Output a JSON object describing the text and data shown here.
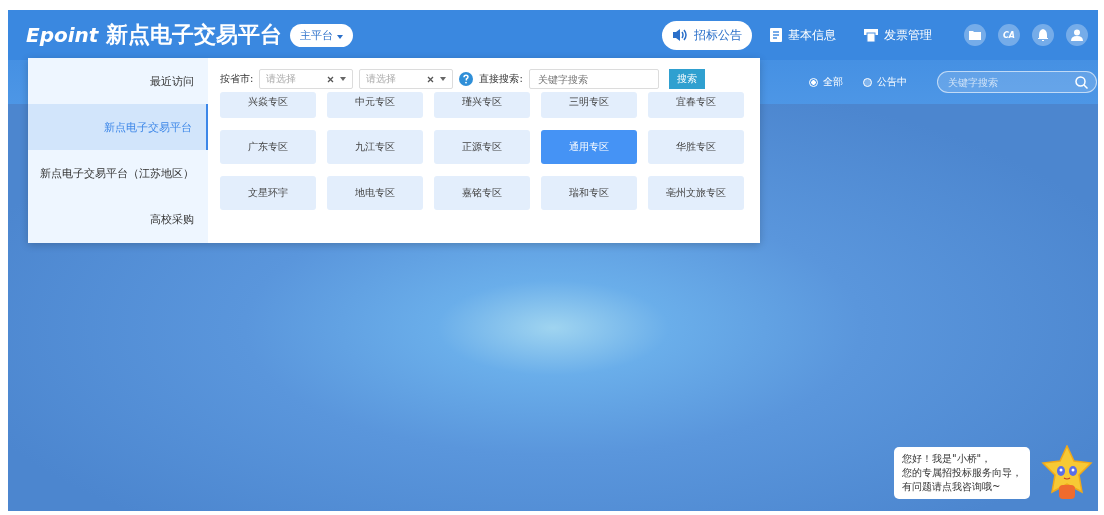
{
  "header": {
    "logo_text": "Epoint",
    "title": "新点电子交易平台",
    "platform_button": "主平台",
    "nav": [
      {
        "label": "招标公告",
        "kind": "speaker",
        "selected": true
      },
      {
        "label": "基本信息",
        "kind": "document",
        "selected": false
      },
      {
        "label": "发票管理",
        "kind": "printer",
        "selected": false
      }
    ],
    "ca_label": "CA"
  },
  "filter_bar": {
    "radios": [
      {
        "label": "全部",
        "selected": true
      },
      {
        "label": "公告中",
        "selected": false
      }
    ],
    "search": {
      "placeholder": "关键字搜索"
    }
  },
  "platform_menu": {
    "sidebar": [
      {
        "label": "最近访问",
        "selected": false
      },
      {
        "label": "新点电子交易平台",
        "selected": true
      },
      {
        "label": "新点电子交易平台（江苏地区）",
        "selected": false
      },
      {
        "label": "高校采购",
        "selected": false
      }
    ],
    "province_label": "按省市:",
    "selects": [
      {
        "placeholder": "请选择"
      },
      {
        "placeholder": "请选择"
      }
    ],
    "search_label": "直接搜索:",
    "search_placeholder": "关键字搜索",
    "search_button": "搜索",
    "zones": [
      {
        "label": "兴焱专区",
        "selected": false
      },
      {
        "label": "中元专区",
        "selected": false
      },
      {
        "label": "瑾兴专区",
        "selected": false
      },
      {
        "label": "三明专区",
        "selected": false
      },
      {
        "label": "宜春专区",
        "selected": false
      },
      {
        "label": "广东专区",
        "selected": false
      },
      {
        "label": "九江专区",
        "selected": false
      },
      {
        "label": "正源专区",
        "selected": false
      },
      {
        "label": "通用专区",
        "selected": true
      },
      {
        "label": "华胜专区",
        "selected": false
      },
      {
        "label": "文星环宇",
        "selected": false
      },
      {
        "label": "地电专区",
        "selected": false
      },
      {
        "label": "嘉铭专区",
        "selected": false
      },
      {
        "label": "瑞和专区",
        "selected": false
      },
      {
        "label": "亳州文旅专区",
        "selected": false
      }
    ]
  },
  "assistant": {
    "lines": [
      "您好！我是\"小桥\"，",
      "您的专属招投标服务向导，",
      "有问题请点我咨询哦~"
    ]
  }
}
